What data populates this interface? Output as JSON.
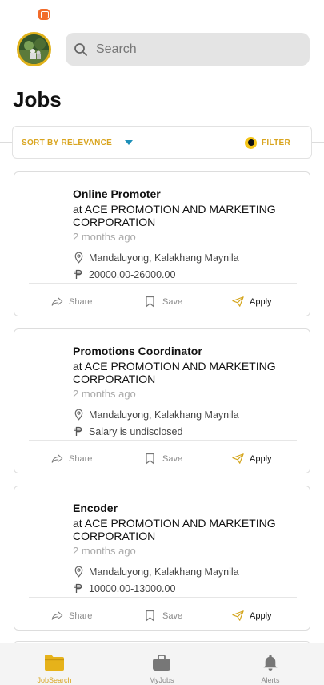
{
  "header": {
    "search_placeholder": "Search"
  },
  "page": {
    "title": "Jobs"
  },
  "sort": {
    "label": "SORT BY RELEVANCE",
    "filter_label": "FILTER"
  },
  "jobs": [
    {
      "title": "Online Promoter",
      "company": "at ACE PROMOTION AND MARKETING CORPORATION",
      "posted": "2 months ago",
      "location": "Mandaluyong, Kalakhang Maynila",
      "salary": "20000.00-26000.00"
    },
    {
      "title": "Promotions Coordinator",
      "company": "at ACE PROMOTION AND MARKETING CORPORATION",
      "posted": "2 months ago",
      "location": "Mandaluyong, Kalakhang Maynila",
      "salary": "Salary is undisclosed"
    },
    {
      "title": "Encoder",
      "company": "at ACE PROMOTION AND MARKETING CORPORATION",
      "posted": "2 months ago",
      "location": "Mandaluyong, Kalakhang Maynila",
      "salary": "10000.00-13000.00"
    }
  ],
  "actions": {
    "share": "Share",
    "save": "Save",
    "apply": "Apply"
  },
  "tabs": [
    {
      "label": "JobSearch",
      "icon": "folder-icon",
      "active": true
    },
    {
      "label": "MyJobs",
      "icon": "briefcase-icon",
      "active": false
    },
    {
      "label": "Alerts",
      "icon": "bell-icon",
      "active": false
    }
  ],
  "colors": {
    "accent": "#d9a520",
    "filter_dot": "#f5c518",
    "caret": "#1d8fb8"
  }
}
